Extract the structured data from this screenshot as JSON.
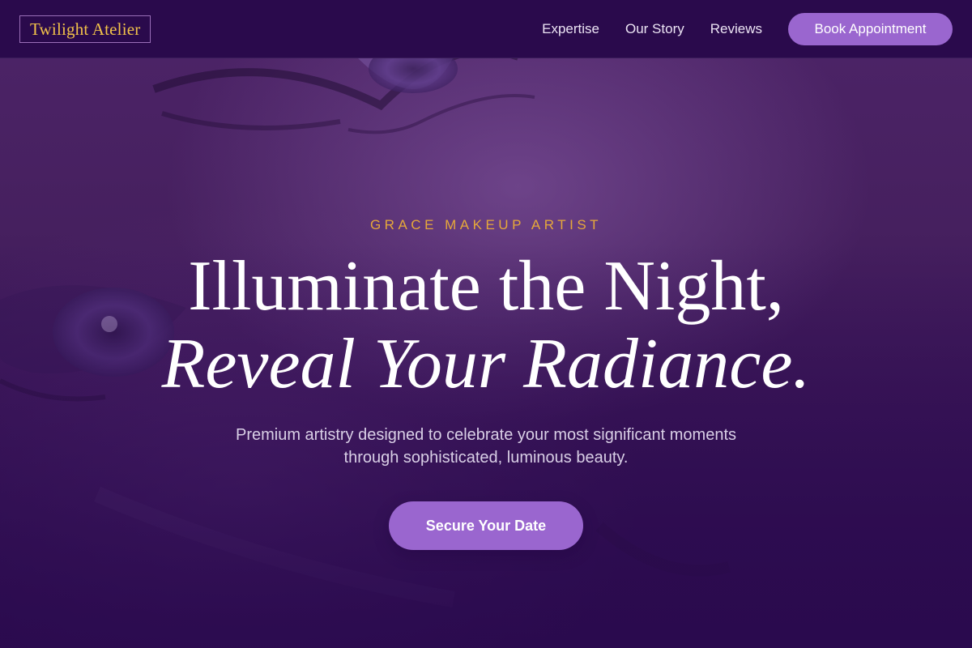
{
  "brand": {
    "name": "Twilight Atelier"
  },
  "nav": {
    "links": [
      {
        "label": "Expertise"
      },
      {
        "label": "Our Story"
      },
      {
        "label": "Reviews"
      }
    ],
    "cta_label": "Book Appointment"
  },
  "hero": {
    "eyebrow": "GRACE MAKEUP ARTIST",
    "headline_line1": "Illuminate the Night,",
    "headline_line2": "Reveal Your Radiance.",
    "subtext": "Premium artistry designed to celebrate your most significant moments through sophisticated, luminous beauty.",
    "cta_label": "Secure Your Date",
    "background_image": "close-up-face-portrait"
  },
  "colors": {
    "nav_background": "#2a0a4c",
    "accent_purple": "#9a66cf",
    "gold": "#f2c24a",
    "eyebrow_gold": "#e6a83a",
    "hero_overlay": "#3b1658"
  }
}
